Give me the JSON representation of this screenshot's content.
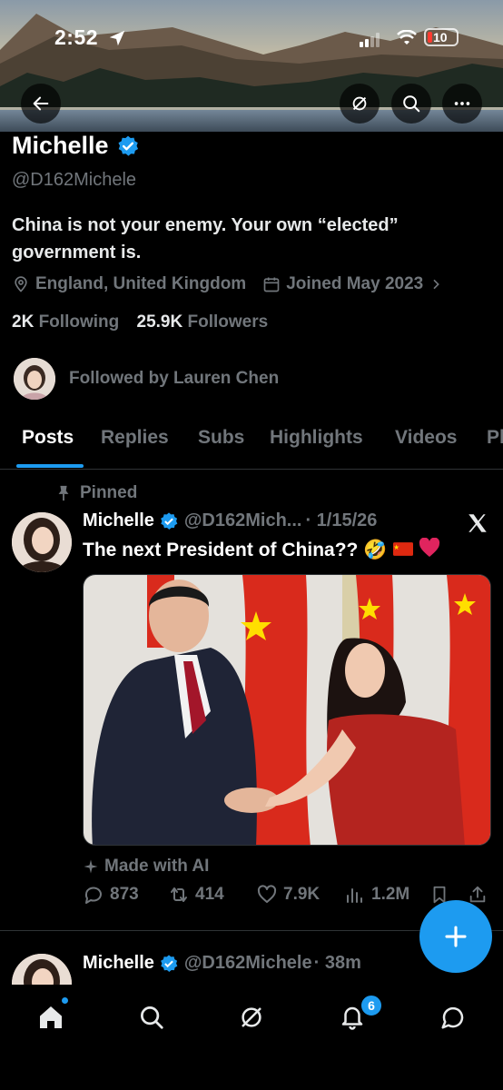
{
  "status_bar": {
    "time": "2:52",
    "battery": "10"
  },
  "profile": {
    "name": "Michelle",
    "handle": "@D162Michele",
    "bio": "China is not your enemy. Your own “elected” government is.",
    "location": "England, United Kingdom",
    "joined": "Joined May 2023",
    "following_count": "2K",
    "following_label": "Following",
    "followers_count": "25.9K",
    "followers_label": "Followers",
    "followed_by": "Followed by Lauren Chen"
  },
  "tabs": [
    {
      "label": "Posts",
      "active": true
    },
    {
      "label": "Replies"
    },
    {
      "label": "Subs"
    },
    {
      "label": "Highlights"
    },
    {
      "label": "Videos"
    },
    {
      "label": "Ph"
    }
  ],
  "pinned_post": {
    "pinned_label": "Pinned",
    "author": "Michelle",
    "handle": "@D162Mich...",
    "date": "· 1/15/26",
    "text": "The next President of China??",
    "emojis": [
      "🤣",
      "🇨🇳",
      "❤️"
    ],
    "ai_label": "Made with AI",
    "replies": "873",
    "reposts": "414",
    "likes": "7.9K",
    "views": "1.2M"
  },
  "second_post": {
    "author": "Michelle",
    "handle": "@D162Michele",
    "time": "· 38m"
  },
  "notifications_badge": "6",
  "colors": {
    "accent": "#1d9bf0",
    "background": "#000000",
    "muted": "#71767b"
  }
}
